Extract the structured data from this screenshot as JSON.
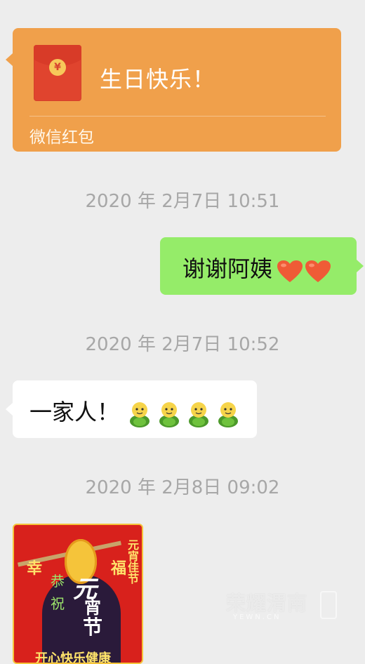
{
  "top_cut_text": "",
  "red_packet": {
    "coin_symbol": "¥",
    "title": "生日快乐！",
    "label": "微信红包",
    "color": "#f0a04b"
  },
  "timestamps": [
    "2020 年 2月7日 10:51",
    "2020 年 2月7日 10:52",
    "2020 年 2月8日 09:02"
  ],
  "messages": {
    "outgoing_1": {
      "text": "谢谢阿姨",
      "emoji": [
        "heart-icon",
        "heart-icon"
      ],
      "color": "#95ec69"
    },
    "incoming_1": {
      "text": "一家人！",
      "emoji": [
        "baby-emoji",
        "baby-emoji",
        "baby-emoji",
        "baby-emoji"
      ],
      "color": "#ffffff"
    }
  },
  "sticker": {
    "xing": "幸",
    "fu": "福",
    "gong": "恭",
    "zhu": "祝",
    "yuan": "元",
    "xiao": "宵",
    "jie": "节",
    "side": "元宵佳节",
    "bottom": "开心快乐健康"
  },
  "watermark": {
    "name": "荣耀渭南",
    "url": "YEWN.CN"
  }
}
